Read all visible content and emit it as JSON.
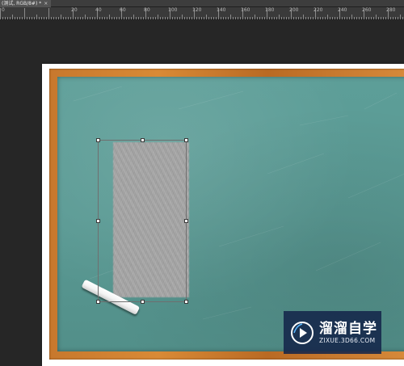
{
  "tab": {
    "title": "(测试, RGB/8#) *",
    "close_icon": "close-icon",
    "close_glyph": "×"
  },
  "ruler": {
    "labels": [
      "0",
      "20",
      "40",
      "60",
      "80",
      "100",
      "120",
      "140",
      "160",
      "180",
      "200",
      "220",
      "240",
      "260",
      "280"
    ]
  },
  "canvas": {
    "background_color": "#262626",
    "board_color": "#5a9a94",
    "frame_color": "#c7782d"
  },
  "watermark": {
    "title": "溜溜自学",
    "url": "ZIXUE.3D66.COM",
    "logo_icon": "play-logo-icon"
  }
}
